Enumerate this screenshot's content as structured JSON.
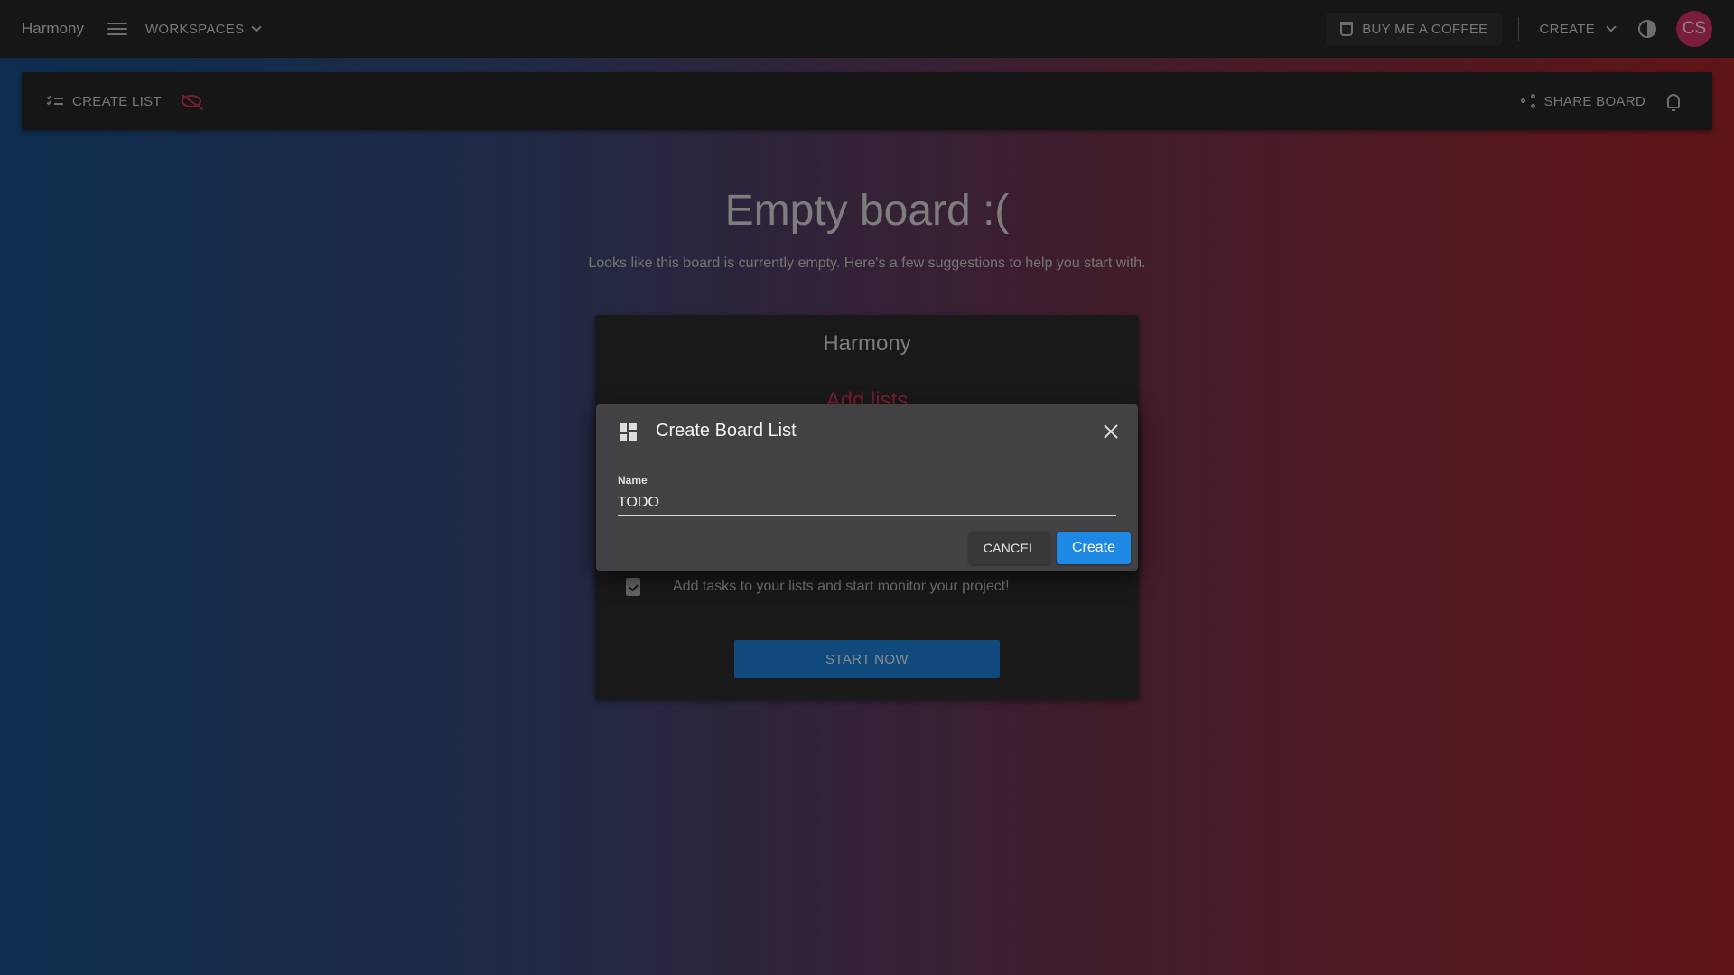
{
  "app": {
    "brand": "Harmony"
  },
  "topbar": {
    "workspaces_label": "WORKSPACES",
    "coffee_label": "BUY ME A COFFEE",
    "create_label": "CREATE",
    "avatar_initials": "CS"
  },
  "board_bar": {
    "create_list_label": "CREATE LIST",
    "share_label": "SHARE BOARD"
  },
  "empty": {
    "title": "Empty board :(",
    "subtitle": "Looks like this board is currently empty. Here's a few suggestions to help you start with."
  },
  "suggestion_card": {
    "title": "Harmony",
    "subtitle": "Add lists",
    "row_text": "Add tasks to your lists and start monitor your project!",
    "start_label": "START NOW"
  },
  "dialog": {
    "title": "Create Board List",
    "field_label": "Name",
    "field_value": "TODO",
    "cancel_label": "CANCEL",
    "create_label": "Create"
  },
  "colors": {
    "accent_blue": "#1e88e5",
    "accent_pink": "#e1356e",
    "accent_red": "#e0305a"
  },
  "icons": [
    "menu-icon",
    "chevron-down-icon",
    "coffee-cup-icon",
    "theme-toggle-icon",
    "checklist-icon",
    "eye-off-icon",
    "share-icon",
    "bell-icon",
    "document-check-icon",
    "dashboard-icon",
    "close-icon"
  ]
}
